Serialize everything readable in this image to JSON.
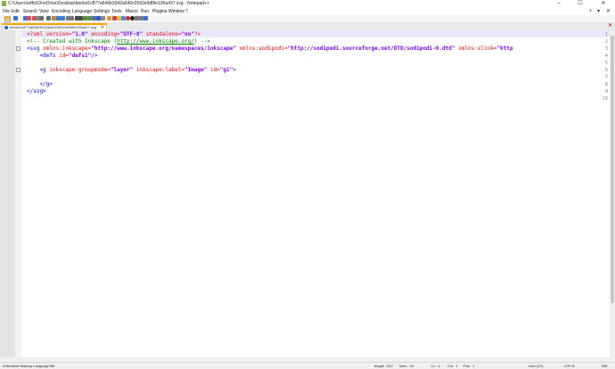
{
  "window": {
    "title": "C:\\Users\\wilfst\\OneDrive\\Desktop\\beebd1cff77a646b3942a640c0592e9df8e195a437.svg - Notepad++",
    "minimize": "–",
    "maximize": "☐",
    "close": "✕"
  },
  "menu": {
    "items": [
      "File",
      "Edit",
      "Search",
      "View",
      "Encoding",
      "Language",
      "Settings",
      "Tools",
      "Macro",
      "Run",
      "Plugins",
      "Window",
      "?"
    ],
    "right": [
      "+",
      "▾",
      "✕"
    ]
  },
  "toolbar": {
    "buttons": [
      "new",
      "open",
      "save",
      "save-all",
      "close",
      "close-all",
      "print",
      "cut",
      "copy",
      "paste",
      "undo",
      "redo",
      "find",
      "replace",
      "zoom-in",
      "zoom-out",
      "sync-v",
      "sync-h",
      "word-wrap",
      "show-all",
      "indent-guide",
      "doc-map",
      "function-list",
      "folder-as-workspace",
      "monitoring",
      "record",
      "stop",
      "playback",
      "run-macro-multi",
      "save-macro"
    ],
    "colors": {
      "new": "#ffffff",
      "open": "#e8b84a",
      "save": "#3b6fd1",
      "save-all": "#3b6fd1",
      "close": "#d05050",
      "close-all": "#d05050",
      "print": "#888888",
      "cut": "#6b6b6b",
      "copy": "#6b6b6b",
      "paste": "#b98a3c",
      "undo": "#3c7ad1",
      "redo": "#3c7ad1",
      "find": "#777777",
      "replace": "#777777",
      "zoom-in": "#4a4a4a",
      "zoom-out": "#4a4a4a",
      "sync-v": "#5a8f3a",
      "sync-h": "#5a8f3a",
      "word-wrap": "#4d6fa8",
      "show-all": "#3355cc",
      "indent-guide": "#8a8a8a",
      "doc-map": "#e19c36",
      "function-list": "#c24b4b",
      "folder-as-workspace": "#e8b84a",
      "monitoring": "#4e8bd6",
      "record": "#d12b2b",
      "stop": "#222222",
      "playback": "#7a7a7a",
      "run-macro-multi": "#7a7a7a",
      "save-macro": "#3b6fd1"
    }
  },
  "tab": {
    "label": "beebd1cff77a646b3942a640c0592e9df8e195a437.svg",
    "close": "✕"
  },
  "tabbar_close": "✕",
  "editor": {
    "line_numbers": [
      "1",
      "2",
      "3",
      "4",
      "5",
      "6",
      "7",
      "8",
      "9",
      "10"
    ],
    "lines": [
      [
        [
          "pi",
          "<?xml "
        ],
        [
          "attr",
          "version="
        ],
        [
          "val",
          "\"1.0\""
        ],
        [
          "attr",
          " encoding="
        ],
        [
          "val",
          "\"UTF-8\""
        ],
        [
          "attr",
          " standalone="
        ],
        [
          "val",
          "\"no\""
        ],
        [
          "pi",
          "?>"
        ]
      ],
      [
        [
          "cmt",
          "<!-- Created with Inkscape ("
        ],
        [
          "lnk",
          "http://www.inkscape.org/"
        ],
        [
          "cmt",
          ") -->"
        ]
      ],
      [
        [
          "tag",
          "<svg "
        ],
        [
          "attr",
          "xmlns:inkscape="
        ],
        [
          "val",
          "\"http://www.inkscape.org/namespaces/inkscape\""
        ],
        [
          "attr",
          " xmlns:sodipodi="
        ],
        [
          "val",
          "\"http://sodipodi.sourceforge.net/DTD/sodipodi-0.dtd\""
        ],
        [
          "attr",
          " xmlns:xlink="
        ],
        [
          "val",
          "\"http"
        ]
      ],
      [
        [
          "tag",
          "    <defs "
        ],
        [
          "attr",
          "id="
        ],
        [
          "val",
          "\"defs1\""
        ],
        [
          "tag",
          "/>"
        ]
      ],
      [],
      [
        [
          "tag",
          "    <g "
        ],
        [
          "attr",
          "inkscape:groupmode="
        ],
        [
          "val",
          "\"layer\""
        ],
        [
          "attr",
          " inkscape:label="
        ],
        [
          "val",
          "\"Image\""
        ],
        [
          "attr",
          " id="
        ],
        [
          "val",
          "\"g1\""
        ],
        [
          "tag",
          ">"
        ]
      ],
      [],
      [
        [
          "tag",
          "    </g>"
        ]
      ],
      [
        [
          "tag",
          "</svg>"
        ]
      ],
      []
    ]
  },
  "status": {
    "type": "eXtensible Markup Language file",
    "length": "length : 617",
    "lines": "lines : 10",
    "ln": "Ln : 1",
    "col": "Col : 1",
    "pos": "Pos : 1",
    "eol": "Unix (LF)",
    "encoding": "UTF-8",
    "mode": "INS"
  }
}
